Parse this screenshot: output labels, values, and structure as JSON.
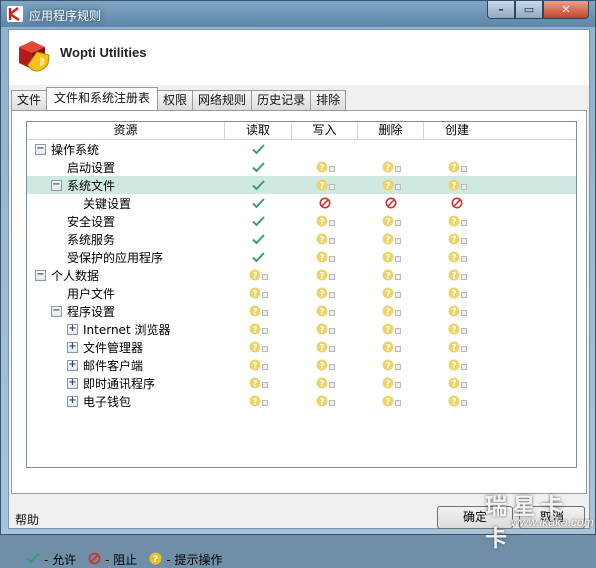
{
  "window": {
    "title": "应用程序规则",
    "buttons": [
      "–",
      "▭",
      "✕"
    ]
  },
  "header": {
    "app_name": "Wopti Utilities"
  },
  "tabs": [
    {
      "label": "文件",
      "active": false
    },
    {
      "label": "文件和系统注册表",
      "active": true
    },
    {
      "label": "权限",
      "active": false
    },
    {
      "label": "网络规则",
      "active": false
    },
    {
      "label": "历史记录",
      "active": false
    },
    {
      "label": "排除",
      "active": false
    }
  ],
  "table": {
    "columns": [
      "资源",
      "读取",
      "写入",
      "删除",
      "创建"
    ],
    "rows": [
      {
        "name": "操作系统",
        "level": 0,
        "expander": "−",
        "read": "allow",
        "write": "",
        "delete": "",
        "create": "",
        "selected": false
      },
      {
        "name": "启动设置",
        "level": 1,
        "expander": "",
        "read": "allow",
        "write": "ask",
        "delete": "ask",
        "create": "ask",
        "selected": false
      },
      {
        "name": "系统文件",
        "level": 1,
        "expander": "−",
        "read": "allow",
        "write": "ask",
        "delete": "ask",
        "create": "ask",
        "selected": true
      },
      {
        "name": "关键设置",
        "level": 2,
        "expander": "",
        "read": "allow",
        "write": "block",
        "delete": "block",
        "create": "block",
        "selected": false
      },
      {
        "name": "安全设置",
        "level": 1,
        "expander": "",
        "read": "allow",
        "write": "ask",
        "delete": "ask",
        "create": "ask",
        "selected": false
      },
      {
        "name": "系统服务",
        "level": 1,
        "expander": "",
        "read": "allow",
        "write": "ask",
        "delete": "ask",
        "create": "ask",
        "selected": false
      },
      {
        "name": "受保护的应用程序",
        "level": 1,
        "expander": "",
        "read": "allow",
        "write": "ask",
        "delete": "ask",
        "create": "ask",
        "selected": false
      },
      {
        "name": "个人数据",
        "level": 0,
        "expander": "−",
        "read": "ask",
        "write": "ask",
        "delete": "ask",
        "create": "ask",
        "selected": false
      },
      {
        "name": "用户文件",
        "level": 1,
        "expander": "",
        "read": "ask",
        "write": "ask",
        "delete": "ask",
        "create": "ask",
        "selected": false
      },
      {
        "name": "程序设置",
        "level": 1,
        "expander": "−",
        "read": "ask",
        "write": "ask",
        "delete": "ask",
        "create": "ask",
        "selected": false
      },
      {
        "name": "Internet 浏览器",
        "level": 2,
        "expander": "+",
        "read": "ask",
        "write": "ask",
        "delete": "ask",
        "create": "ask",
        "selected": false
      },
      {
        "name": "文件管理器",
        "level": 2,
        "expander": "+",
        "read": "ask",
        "write": "ask",
        "delete": "ask",
        "create": "ask",
        "selected": false
      },
      {
        "name": "邮件客户端",
        "level": 2,
        "expander": "+",
        "read": "ask",
        "write": "ask",
        "delete": "ask",
        "create": "ask",
        "selected": false
      },
      {
        "name": "即时通讯程序",
        "level": 2,
        "expander": "+",
        "read": "ask",
        "write": "ask",
        "delete": "ask",
        "create": "ask",
        "selected": false
      },
      {
        "name": "电子钱包",
        "level": 2,
        "expander": "+",
        "read": "ask",
        "write": "ask",
        "delete": "ask",
        "create": "ask",
        "selected": false
      }
    ]
  },
  "legend": {
    "allow": "- 允许",
    "block": "- 阻止",
    "ask": "- 提示操作"
  },
  "footer": {
    "help": "帮助",
    "ok": "确定",
    "cancel": "取消"
  },
  "watermark": {
    "big": "瑞星卡卡",
    "small": "www.ikaka.com"
  },
  "colors": {
    "allow": "#3a9a7a",
    "block": "#cc3333",
    "ask": "#e8c22c",
    "selected_row": "#cfe8e2"
  }
}
